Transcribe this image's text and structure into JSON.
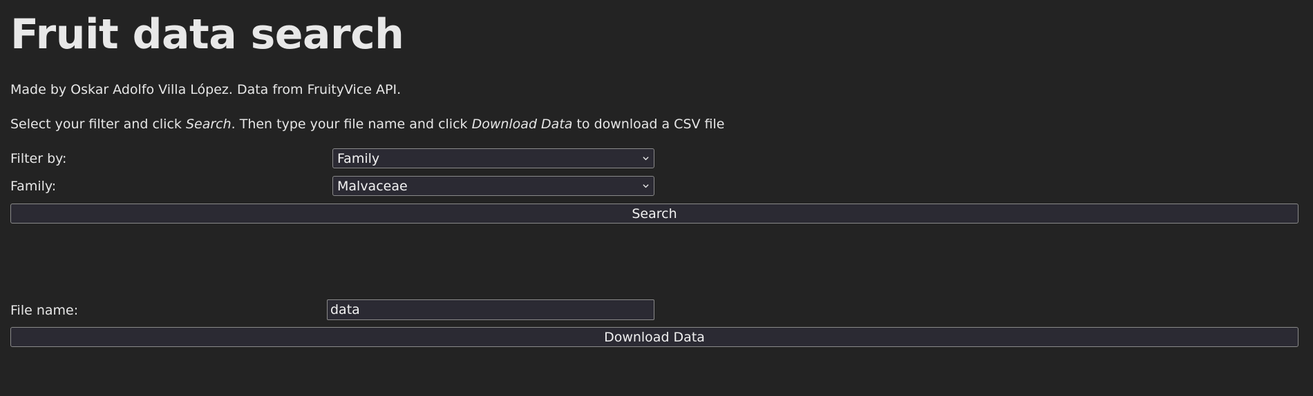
{
  "page": {
    "title": "Fruit data search",
    "credits": "Made by Oskar Adolfo Villa López. Data from FruityVice API.",
    "instructions": {
      "part1": "Select your filter and click ",
      "em1": "Search",
      "part2": ". Then type your file name and click ",
      "em2": "Download Data",
      "part3": " to download a CSV file"
    }
  },
  "filter": {
    "label": "Filter by:",
    "selected": "Family"
  },
  "family": {
    "label": "Family:",
    "selected": "Malvaceae"
  },
  "search_button": {
    "label": "Search"
  },
  "file_name": {
    "label": "File name:",
    "value": "data"
  },
  "download_button": {
    "label": "Download Data"
  },
  "icons": {
    "dropdown": "chevron-down-icon"
  }
}
